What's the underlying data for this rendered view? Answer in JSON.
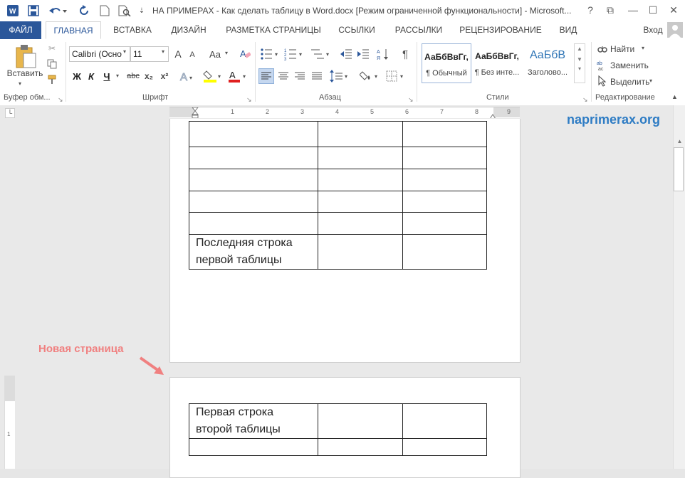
{
  "window": {
    "title": "НА ПРИМЕРАХ - Как сделать таблицу в Word.docx [Режим ограниченной функциональности] - Microsoft...",
    "help": "?",
    "controls": {
      "restore": "⧉",
      "minimize": "—",
      "maximize": "☐",
      "close": "✕"
    }
  },
  "tabs": {
    "file": "ФАЙЛ",
    "home": "ГЛАВНАЯ",
    "insert": "ВСТАВКА",
    "design": "ДИЗАЙН",
    "layout": "РАЗМЕТКА СТРАНИЦЫ",
    "references": "ССЫЛКИ",
    "mailings": "РАССЫЛКИ",
    "review": "РЕЦЕНЗИРОВАНИЕ",
    "view": "ВИД",
    "signin": "Вход"
  },
  "ribbon": {
    "clipboard": {
      "paste": "Вставить",
      "label": "Буфер обм..."
    },
    "font": {
      "name": "Calibri (Осно",
      "size": "11",
      "label": "Шрифт",
      "bold": "Ж",
      "italic": "К",
      "underline": "Ч",
      "strike": "abc",
      "sub": "x₂",
      "sup": "x²",
      "grow": "A",
      "shrink": "A",
      "case": "Aa"
    },
    "paragraph": {
      "label": "Абзац",
      "pilcrow": "¶"
    },
    "styles": {
      "label": "Стили",
      "items": [
        {
          "sample": "АаБбВвГг,",
          "name": "¶ Обычный"
        },
        {
          "sample": "АаБбВвГг,",
          "name": "¶ Без инте..."
        },
        {
          "sample": "АаБбВ",
          "name": "Заголово..."
        }
      ]
    },
    "editing": {
      "label": "Редактирование",
      "find": "Найти",
      "replace": "Заменить",
      "select": "Выделить"
    }
  },
  "ruler": {
    "numbers": [
      "1",
      "2",
      "3",
      "4",
      "5",
      "6",
      "7",
      "8",
      "9"
    ]
  },
  "watermark": "naprimerax.org",
  "annotation": "Новая страница",
  "document": {
    "table1_last_row": "Последняя строка первой таблицы",
    "table2_first_row": "Первая строка второй таблицы"
  },
  "colors": {
    "accent": "#2b579a",
    "annotation": "#f08080",
    "watermark": "#2e7cc4"
  }
}
